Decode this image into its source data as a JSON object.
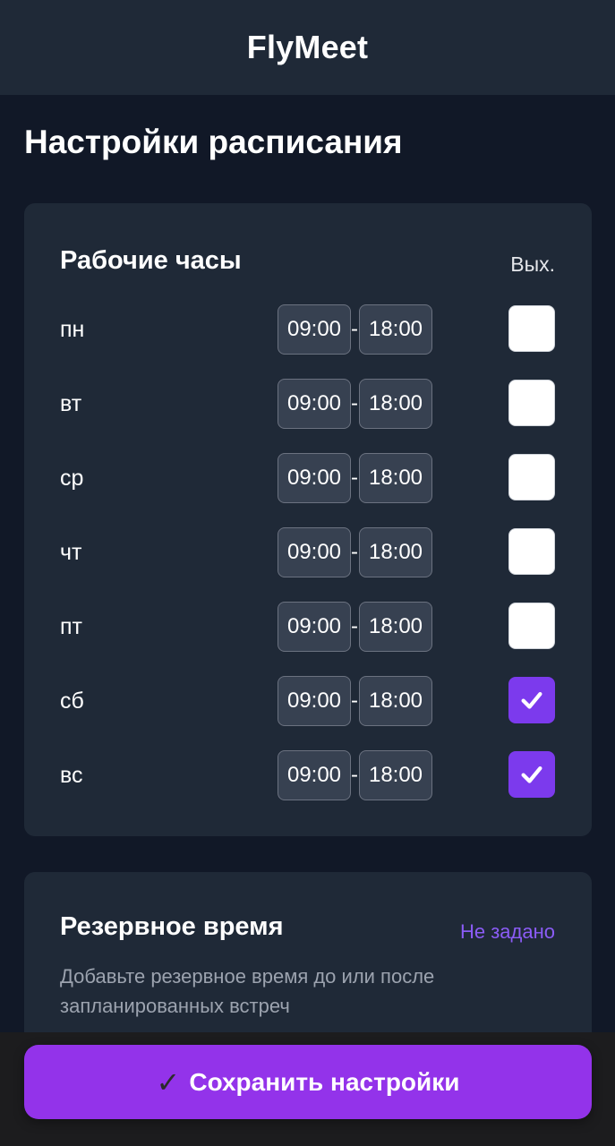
{
  "app": {
    "title": "FlyMeet"
  },
  "page": {
    "title": "Настройки расписания"
  },
  "working_hours": {
    "title": "Рабочие часы",
    "day_off_header": "Вых.",
    "separator": "-",
    "days": [
      {
        "label": "пн",
        "start": "09:00",
        "end": "18:00",
        "day_off": false
      },
      {
        "label": "вт",
        "start": "09:00",
        "end": "18:00",
        "day_off": false
      },
      {
        "label": "ср",
        "start": "09:00",
        "end": "18:00",
        "day_off": false
      },
      {
        "label": "чт",
        "start": "09:00",
        "end": "18:00",
        "day_off": false
      },
      {
        "label": "пт",
        "start": "09:00",
        "end": "18:00",
        "day_off": false
      },
      {
        "label": "сб",
        "start": "09:00",
        "end": "18:00",
        "day_off": true
      },
      {
        "label": "вс",
        "start": "09:00",
        "end": "18:00",
        "day_off": true
      }
    ]
  },
  "buffer_time": {
    "title": "Резервное время",
    "status": "Не задано",
    "description": "Добавьте резервное время до или после запланированных встреч"
  },
  "save_button": {
    "icon": "✓",
    "label": "Сохранить настройки"
  },
  "colors": {
    "accent": "#7c3aed",
    "button": "#9333ea",
    "status_link": "#8b5cf6",
    "background": "#111827",
    "card": "#1f2937"
  }
}
